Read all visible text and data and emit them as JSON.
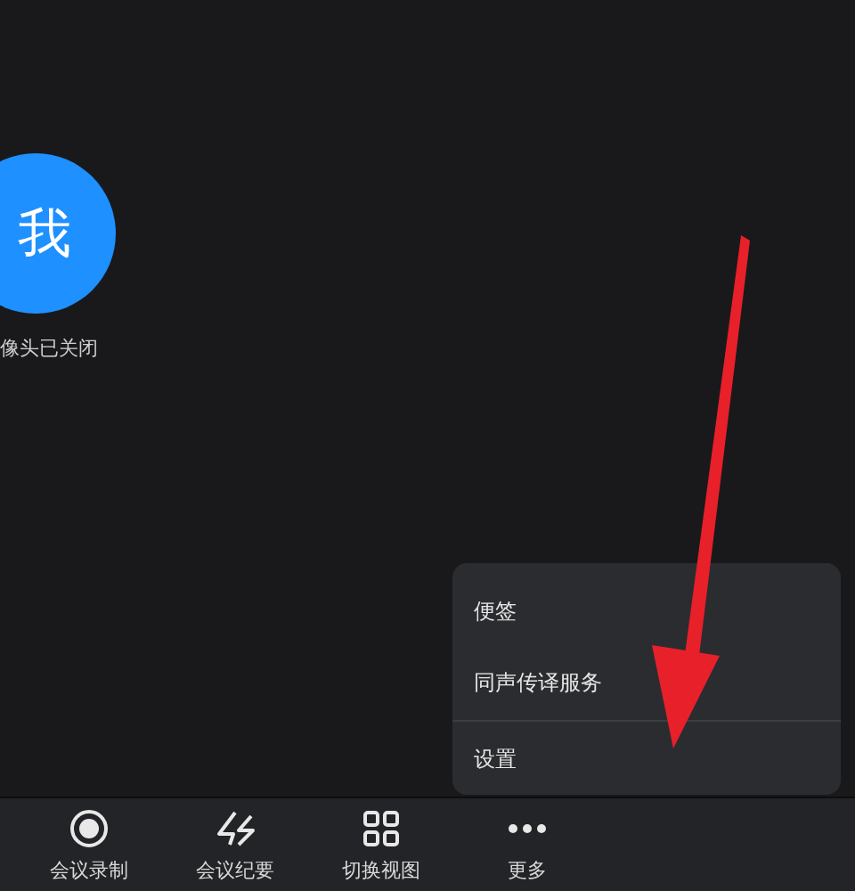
{
  "participant": {
    "avatar_text": "我",
    "status": "像头已关闭"
  },
  "toolbar": [
    {
      "kind": "record",
      "label": "会议录制"
    },
    {
      "kind": "minutes",
      "label": "会议纪要"
    },
    {
      "kind": "grid",
      "label": "切换视图"
    },
    {
      "kind": "more",
      "label": "更多"
    }
  ],
  "menu": {
    "items": [
      {
        "label": "便签",
        "divider_before": false
      },
      {
        "label": "同声传译服务",
        "divider_before": false
      },
      {
        "label": "设置",
        "divider_before": true
      }
    ]
  }
}
